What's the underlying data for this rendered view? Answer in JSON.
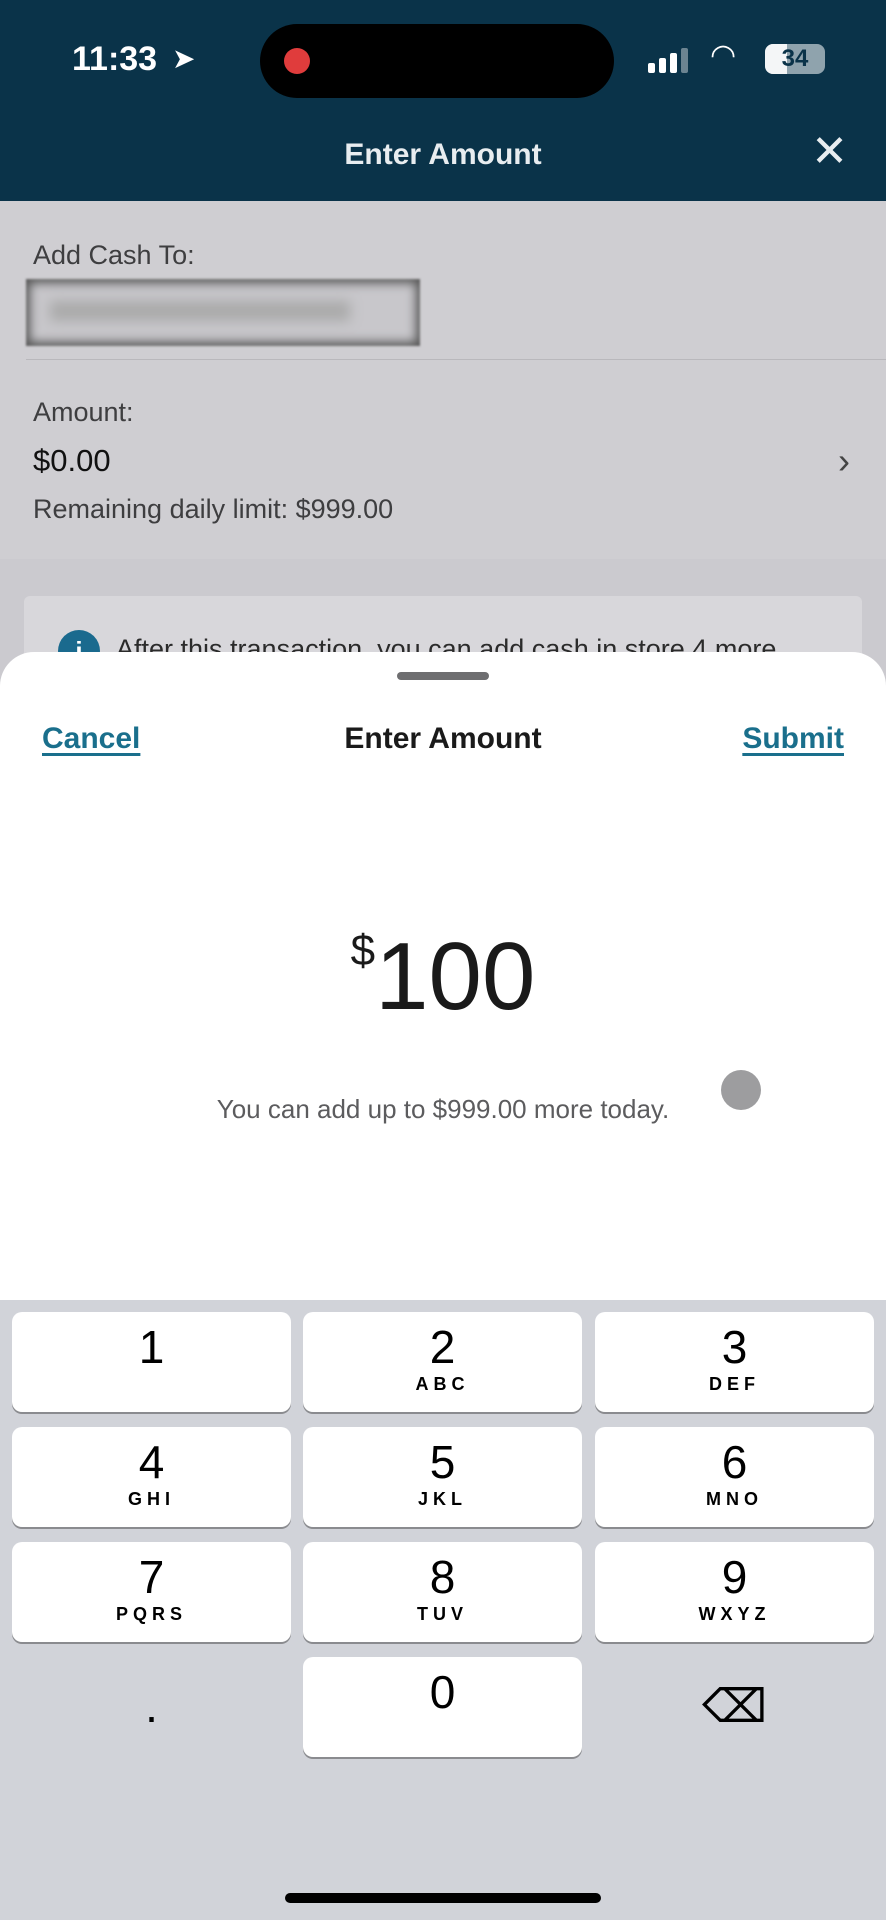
{
  "status_bar": {
    "time": "11:33",
    "battery": "34"
  },
  "header": {
    "title": "Enter Amount",
    "close_icon": "close-icon"
  },
  "form": {
    "add_cash_label": "Add Cash To:",
    "amount_label": "Amount:",
    "amount_value": "$0.00",
    "remaining_limit": "Remaining daily limit: $999.00",
    "info_text": "After this transaction, you can add cash in store 4 more"
  },
  "sheet": {
    "cancel": "Cancel",
    "title": "Enter Amount",
    "submit": "Submit",
    "currency": "$",
    "amount": "100",
    "hint": "You can add up to $999.00 more today."
  },
  "colors": {
    "header_bg": "#0a3349",
    "link": "#1a6f8c",
    "info_icon": "#1a6a8e"
  },
  "keypad": {
    "keys": [
      {
        "n": "1",
        "l": ""
      },
      {
        "n": "2",
        "l": "ABC"
      },
      {
        "n": "3",
        "l": "DEF"
      },
      {
        "n": "4",
        "l": "GHI"
      },
      {
        "n": "5",
        "l": "JKL"
      },
      {
        "n": "6",
        "l": "MNO"
      },
      {
        "n": "7",
        "l": "PQRS"
      },
      {
        "n": "8",
        "l": "TUV"
      },
      {
        "n": "9",
        "l": "WXYZ"
      },
      {
        "n": ".",
        "l": ""
      },
      {
        "n": "0",
        "l": ""
      },
      {
        "n": "⌫",
        "l": ""
      }
    ]
  }
}
